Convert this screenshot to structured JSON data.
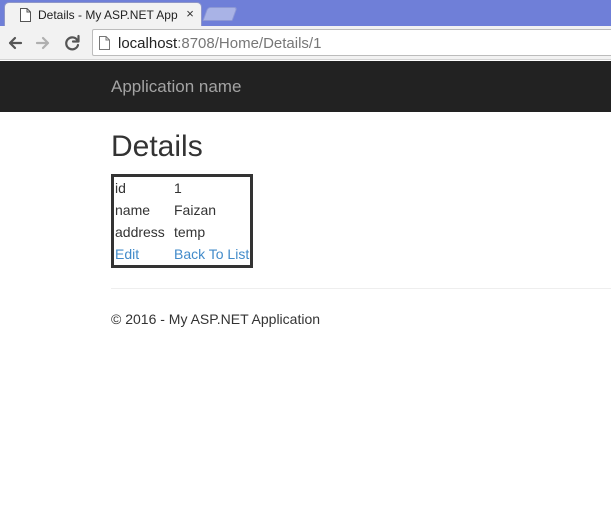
{
  "browser": {
    "tab": {
      "title": "Details - My ASP.NET App",
      "close_glyph": "×",
      "favicon": "document-icon"
    },
    "address_bar": {
      "host": "localhost",
      "path": ":8708/Home/Details/1"
    }
  },
  "site": {
    "brand": "Application name",
    "page_title": "Details",
    "details": {
      "rows": [
        {
          "label": "id",
          "value": "1"
        },
        {
          "label": "name",
          "value": "Faizan"
        },
        {
          "label": "address",
          "value": "temp"
        }
      ],
      "links": {
        "edit": "Edit",
        "back": "Back To List"
      }
    },
    "footer": "© 2016 - My ASP.NET Application"
  },
  "colors": {
    "navbar": "#222222",
    "brand_text": "#a3a3a3",
    "link": "#428bca",
    "tabstrip": "#6f7fd8"
  }
}
